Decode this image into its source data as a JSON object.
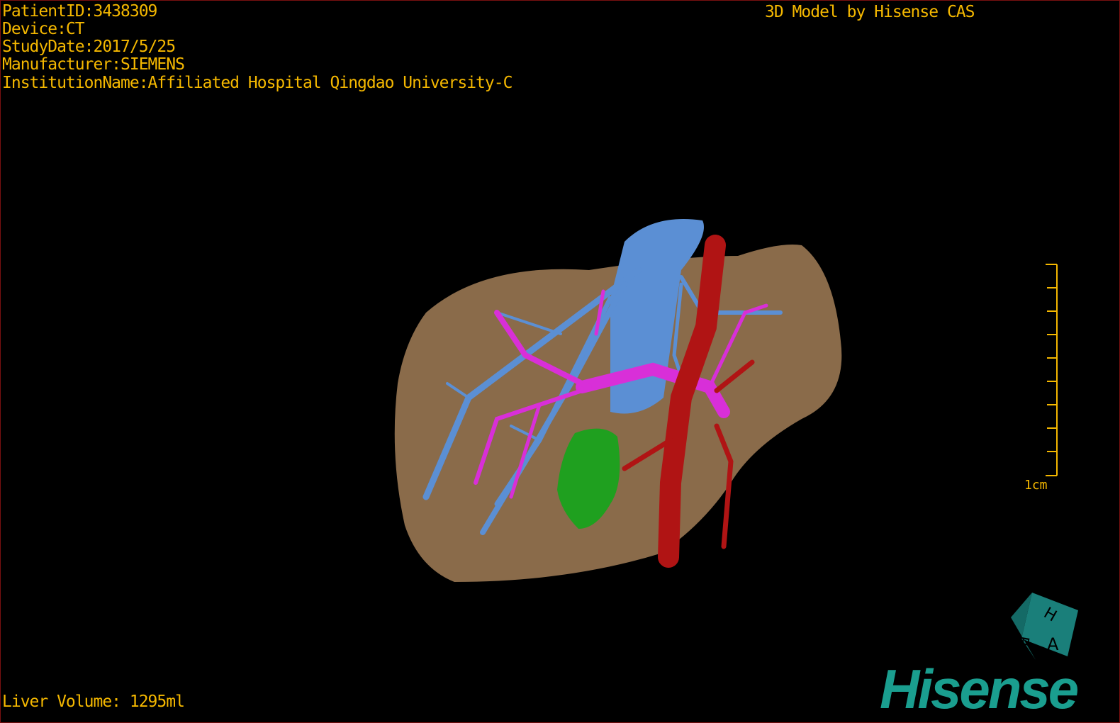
{
  "overlay": {
    "patient_id": "PatientID:3438309",
    "device": "Device:CT",
    "study_date": "StudyDate:2017/5/25",
    "manufacturer": "Manufacturer:SIEMENS",
    "institution": "InstitutionName:Affiliated Hospital Qingdao University-C",
    "title": "3D Model by Hisense CAS",
    "liver_volume": "Liver Volume: 1295ml"
  },
  "scale_bar": {
    "label": "1cm"
  },
  "orientation_cube": {
    "faces": [
      "H",
      "R",
      "A"
    ],
    "color": "#1a7f7a"
  },
  "logo": {
    "text": "Hisense",
    "color": "#1a9e8f"
  },
  "colors": {
    "text": "#f5b800",
    "liver": "#8a6b4a",
    "hepatic_vein": "#5b8fd4",
    "portal_vein": "#d82fd8",
    "artery": "#b01414",
    "gallbladder": "#1fa01f"
  }
}
